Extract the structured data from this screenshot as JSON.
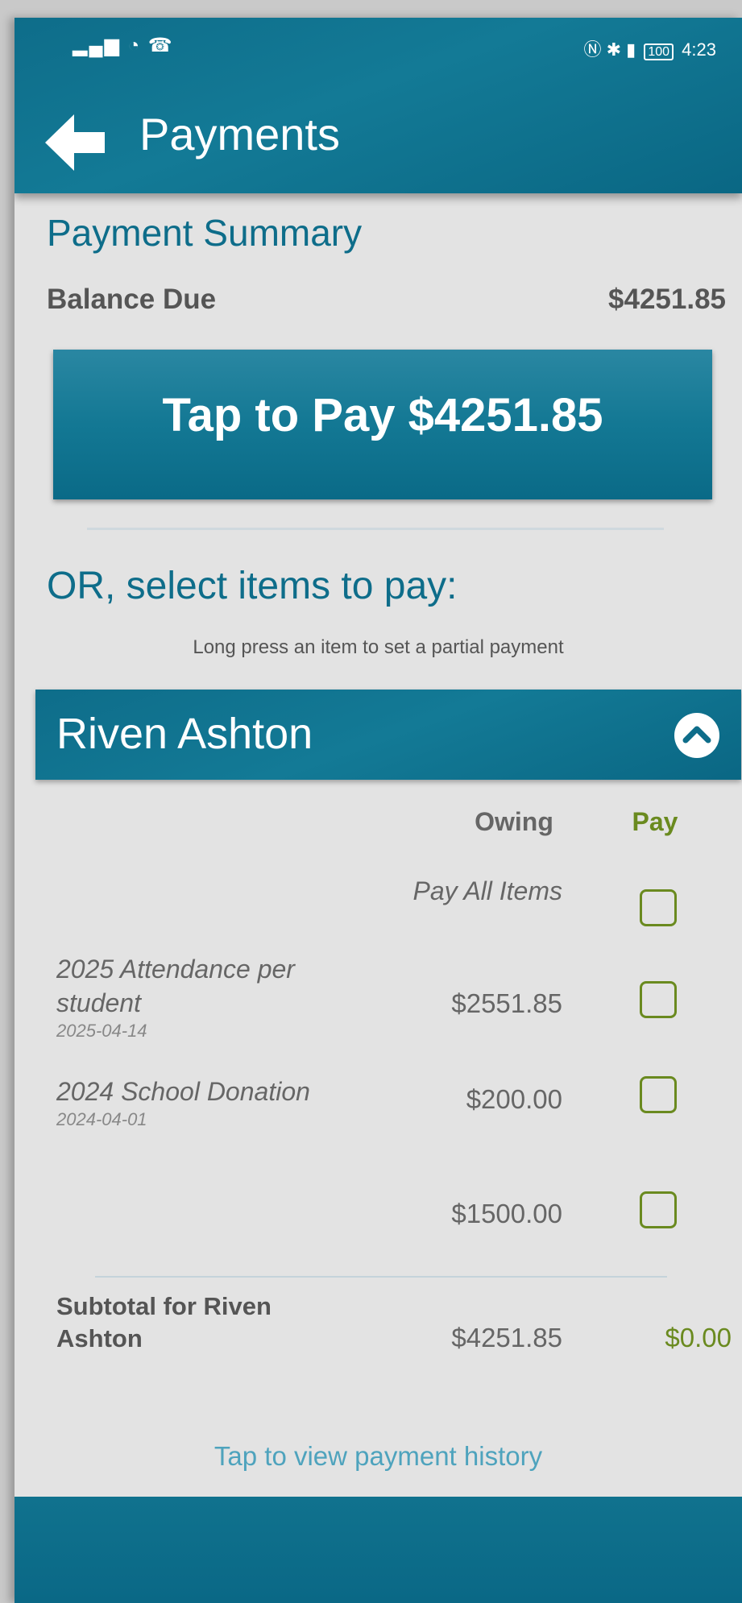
{
  "status_bar": {
    "left_icons": "▂▄▆ ◔ ☎",
    "right_icons": "Ⓝ ✱ ▮",
    "battery": "100",
    "time": "4:23"
  },
  "header": {
    "title": "Payments"
  },
  "summary": {
    "heading": "Payment Summary",
    "balance_label": "Balance Due",
    "balance_value": "$4251.85",
    "pay_button_label": "Tap to Pay $4251.85"
  },
  "select": {
    "heading": "OR, select items to pay:",
    "hint": "Long press an item to set a partial payment"
  },
  "student": {
    "name": "Riven Ashton",
    "columns": {
      "owing": "Owing",
      "pay": "Pay"
    },
    "pay_all_label": "Pay All Items",
    "items": [
      {
        "description": "2025 Attendance per student",
        "date": "2025-04-14",
        "owing": "$2551.85"
      },
      {
        "description": "2024 School Donation",
        "date": "2024-04-01",
        "owing": "$200.00"
      },
      {
        "description": "",
        "date": "",
        "owing": "$1500.00"
      }
    ],
    "subtotal": {
      "label": "Subtotal for Riven Ashton",
      "owing": "$4251.85",
      "pay": "$0.00"
    },
    "history_link": "Tap to view payment history"
  },
  "colors": {
    "primary": "#0e6d8a",
    "accent_green": "#6a8a1f",
    "link": "#4ea3bd",
    "background": "#e3e3e3"
  },
  "icons": {
    "back": "arrow-left-icon",
    "collapse": "chevron-up-circle-icon",
    "checkbox": "checkbox-unchecked-icon"
  }
}
